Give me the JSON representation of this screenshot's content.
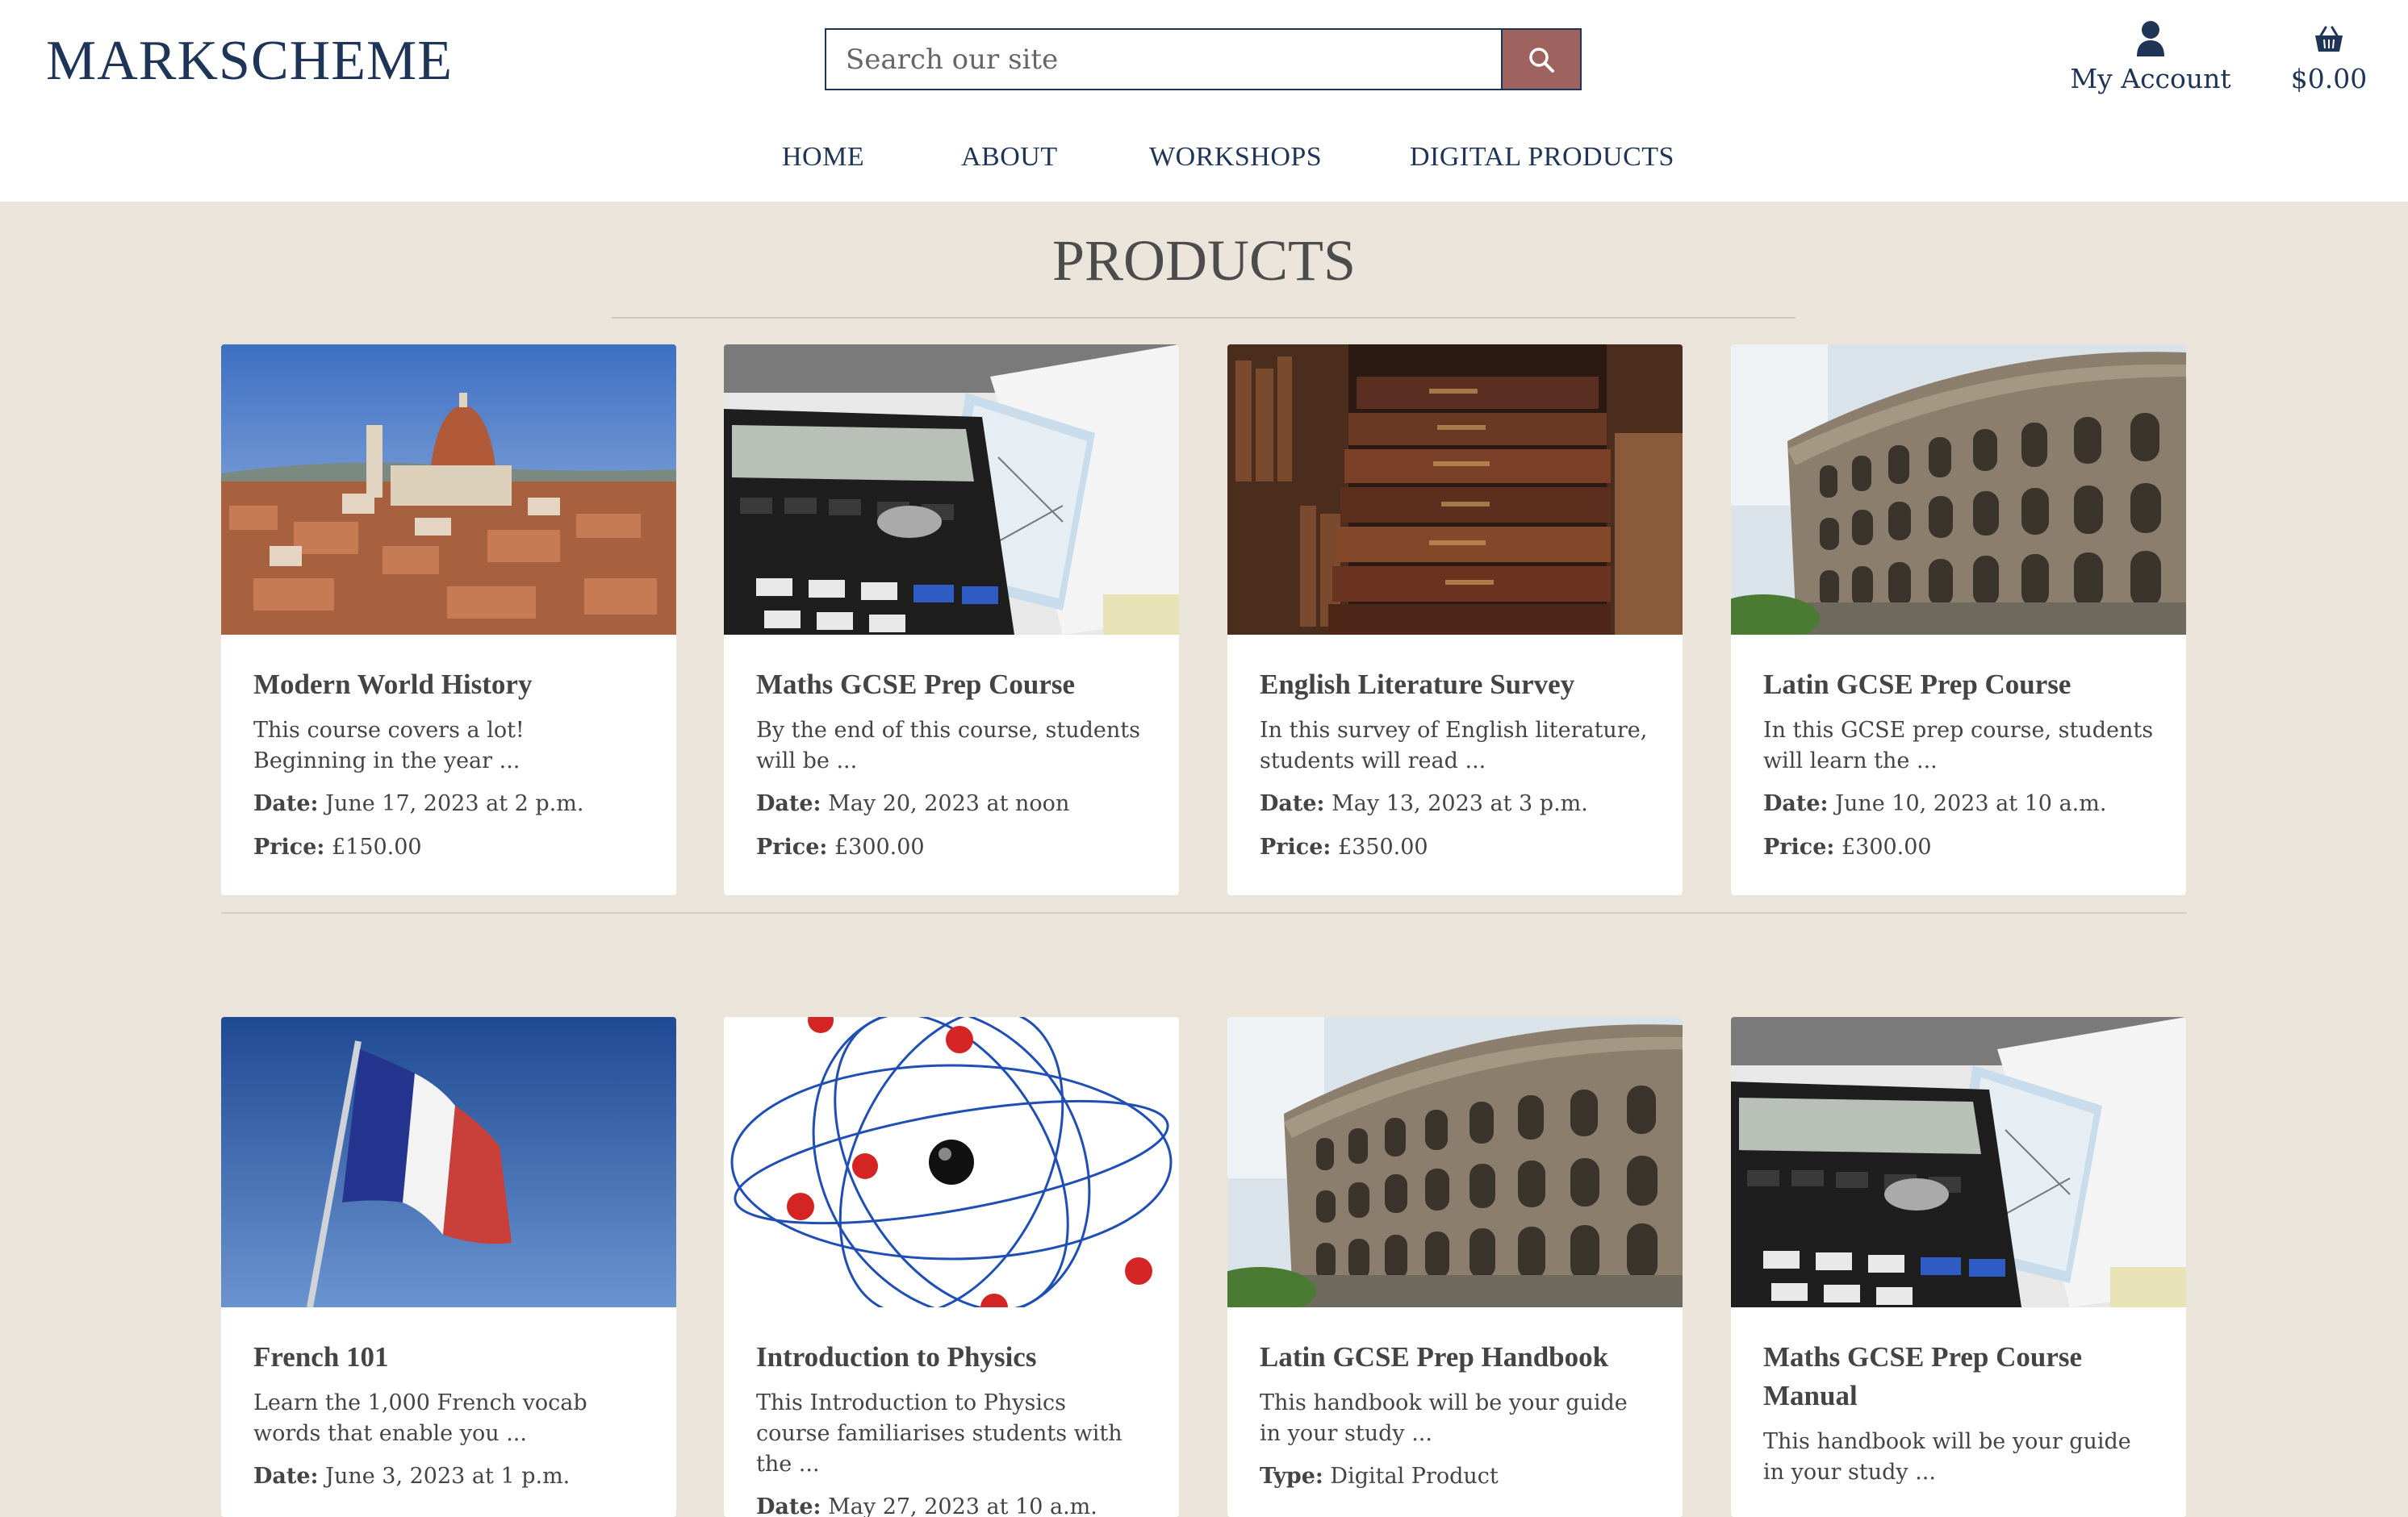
{
  "header": {
    "logo": "MARKSCHEME",
    "search_placeholder": "Search our site",
    "account_label": "My Account",
    "cart_total": "$0.00"
  },
  "nav": [
    {
      "label": "HOME"
    },
    {
      "label": "ABOUT"
    },
    {
      "label": "WORKSHOPS"
    },
    {
      "label": "DIGITAL PRODUCTS"
    }
  ],
  "main": {
    "title": "PRODUCTS",
    "products": [
      {
        "title": "Modern World History",
        "desc": "This course covers a lot! Beginning in the year ...",
        "meta1_label": "Date:",
        "meta1_value": " June 17, 2023 at 2 p.m.",
        "meta2_label": "Price:",
        "meta2_value": " £150.00",
        "image": "florence-cityscape"
      },
      {
        "title": "Maths GCSE Prep Course",
        "desc": "By the end of this course, students will be ...",
        "meta1_label": "Date:",
        "meta1_value": " May 20, 2023 at noon",
        "meta2_label": "Price:",
        "meta2_value": " £300.00",
        "image": "calculator-notes"
      },
      {
        "title": "English Literature Survey",
        "desc": "In this survey of English literature, students will read ...",
        "meta1_label": "Date:",
        "meta1_value": " May 13, 2023 at 3 p.m.",
        "meta2_label": "Price:",
        "meta2_value": " £350.00",
        "image": "antique-books"
      },
      {
        "title": "Latin GCSE Prep Course",
        "desc": "In this GCSE prep course, students will learn the ...",
        "meta1_label": "Date:",
        "meta1_value": " June 10, 2023 at 10 a.m.",
        "meta2_label": "Price:",
        "meta2_value": " £300.00",
        "image": "colosseum"
      },
      {
        "title": "French 101",
        "desc": "Learn the 1,000 French vocab words that enable you ...",
        "meta1_label": "Date:",
        "meta1_value": " June 3, 2023 at 1 p.m.",
        "image": "french-flag"
      },
      {
        "title": "Introduction to Physics",
        "desc": "This Introduction to Physics course familiarises students with the ...",
        "meta1_label": "Date:",
        "meta1_value": " May 27, 2023 at 10 a.m.",
        "image": "atom-model"
      },
      {
        "title": "Latin GCSE Prep Handbook",
        "desc": "This handbook will be your guide in your study ...",
        "meta1_label": "Type:",
        "meta1_value": " Digital Product",
        "image": "colosseum"
      },
      {
        "title": "Maths GCSE Prep Course Manual",
        "desc": "This handbook will be your guide in your study ...",
        "image": "calculator-notes"
      }
    ]
  }
}
